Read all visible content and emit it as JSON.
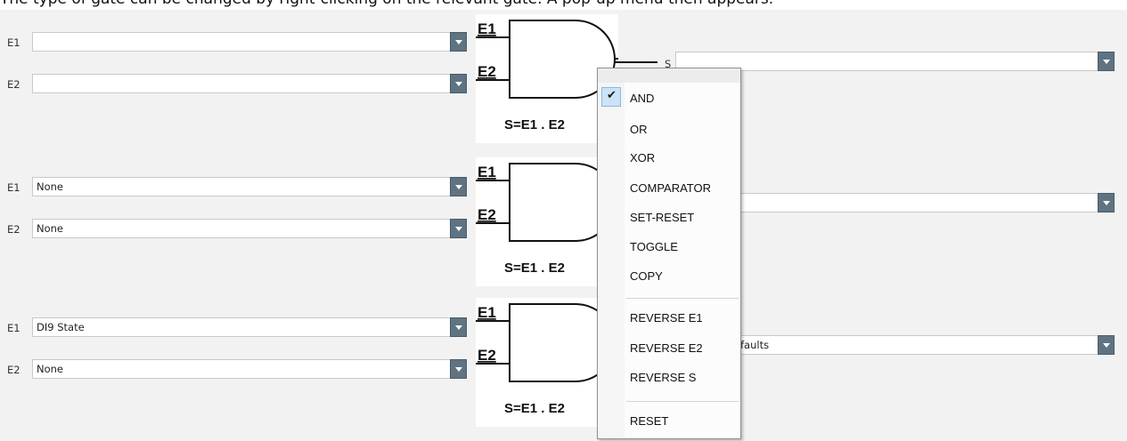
{
  "caption": "The type of gate can be changed by right-clicking on the relevant gate. A pop-up menu then appears.",
  "rows": [
    {
      "e1_label": "E1",
      "e1_value": "",
      "e2_label": "E2",
      "e2_value": "",
      "s_label": "S",
      "s_value": ""
    },
    {
      "e1_label": "E1",
      "e1_value": "None",
      "e2_label": "E2",
      "e2_value": "None",
      "s_value": ""
    },
    {
      "e1_label": "E1",
      "e1_value": "DI9 State",
      "e2_label": "E2",
      "e2_value": "None",
      "s_value": "faults"
    }
  ],
  "gate": {
    "in1": "E1",
    "in2": "E2",
    "out": "S",
    "formula": "S=E1 . E2"
  },
  "context_menu": {
    "checked_item": "AND",
    "group1": [
      "AND",
      "OR",
      "XOR",
      "COMPARATOR",
      "SET-RESET",
      "TOGGLE",
      "COPY"
    ],
    "group2": [
      "REVERSE E1",
      "REVERSE E2",
      "REVERSE S"
    ],
    "group3": [
      "RESET"
    ]
  },
  "icons": {
    "check": "checkmark-icon",
    "dropdown": "chevron-down-icon"
  }
}
